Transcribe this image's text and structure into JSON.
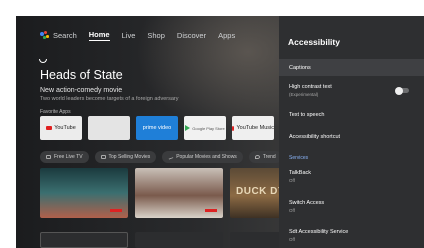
{
  "nav": {
    "items": [
      "Search",
      "Home",
      "Live",
      "Shop",
      "Discover",
      "Apps"
    ],
    "active": "Home"
  },
  "hero": {
    "title": "Heads of State",
    "subtitle": "New action-comedy movie",
    "description": "Two world leaders become targets of a foreign adversary"
  },
  "favorites": {
    "label": "Favorite Apps",
    "apps": [
      "YouTube",
      "",
      "prime video",
      "Google Play Store",
      "YouTube Music"
    ]
  },
  "chips": [
    "Free Live TV",
    "Top Selling Movies",
    "Popular Movies and Shows",
    "Trend"
  ],
  "cards": {
    "duck_text": "DUCK DY"
  },
  "panel": {
    "title": "Accessibility",
    "captions": "Captions",
    "high_contrast": {
      "label": "High contrast text",
      "sub": "(Experimental)",
      "enabled": false
    },
    "text_to_speech": "Text to speech",
    "shortcut": "Accessibility shortcut",
    "services_header": "Services",
    "talkback": {
      "label": "TalkBack",
      "status": "Off"
    },
    "switch_access": {
      "label": "Switch Access",
      "status": "Off"
    },
    "sdt": {
      "label": "Sdt Accessibility Service",
      "status": "Off"
    }
  },
  "colors": {
    "panel_bg": "#2e2f31",
    "selected_row": "#3f4043",
    "services_accent": "#8ab4f8",
    "prime_blue": "#1f7fd8"
  }
}
